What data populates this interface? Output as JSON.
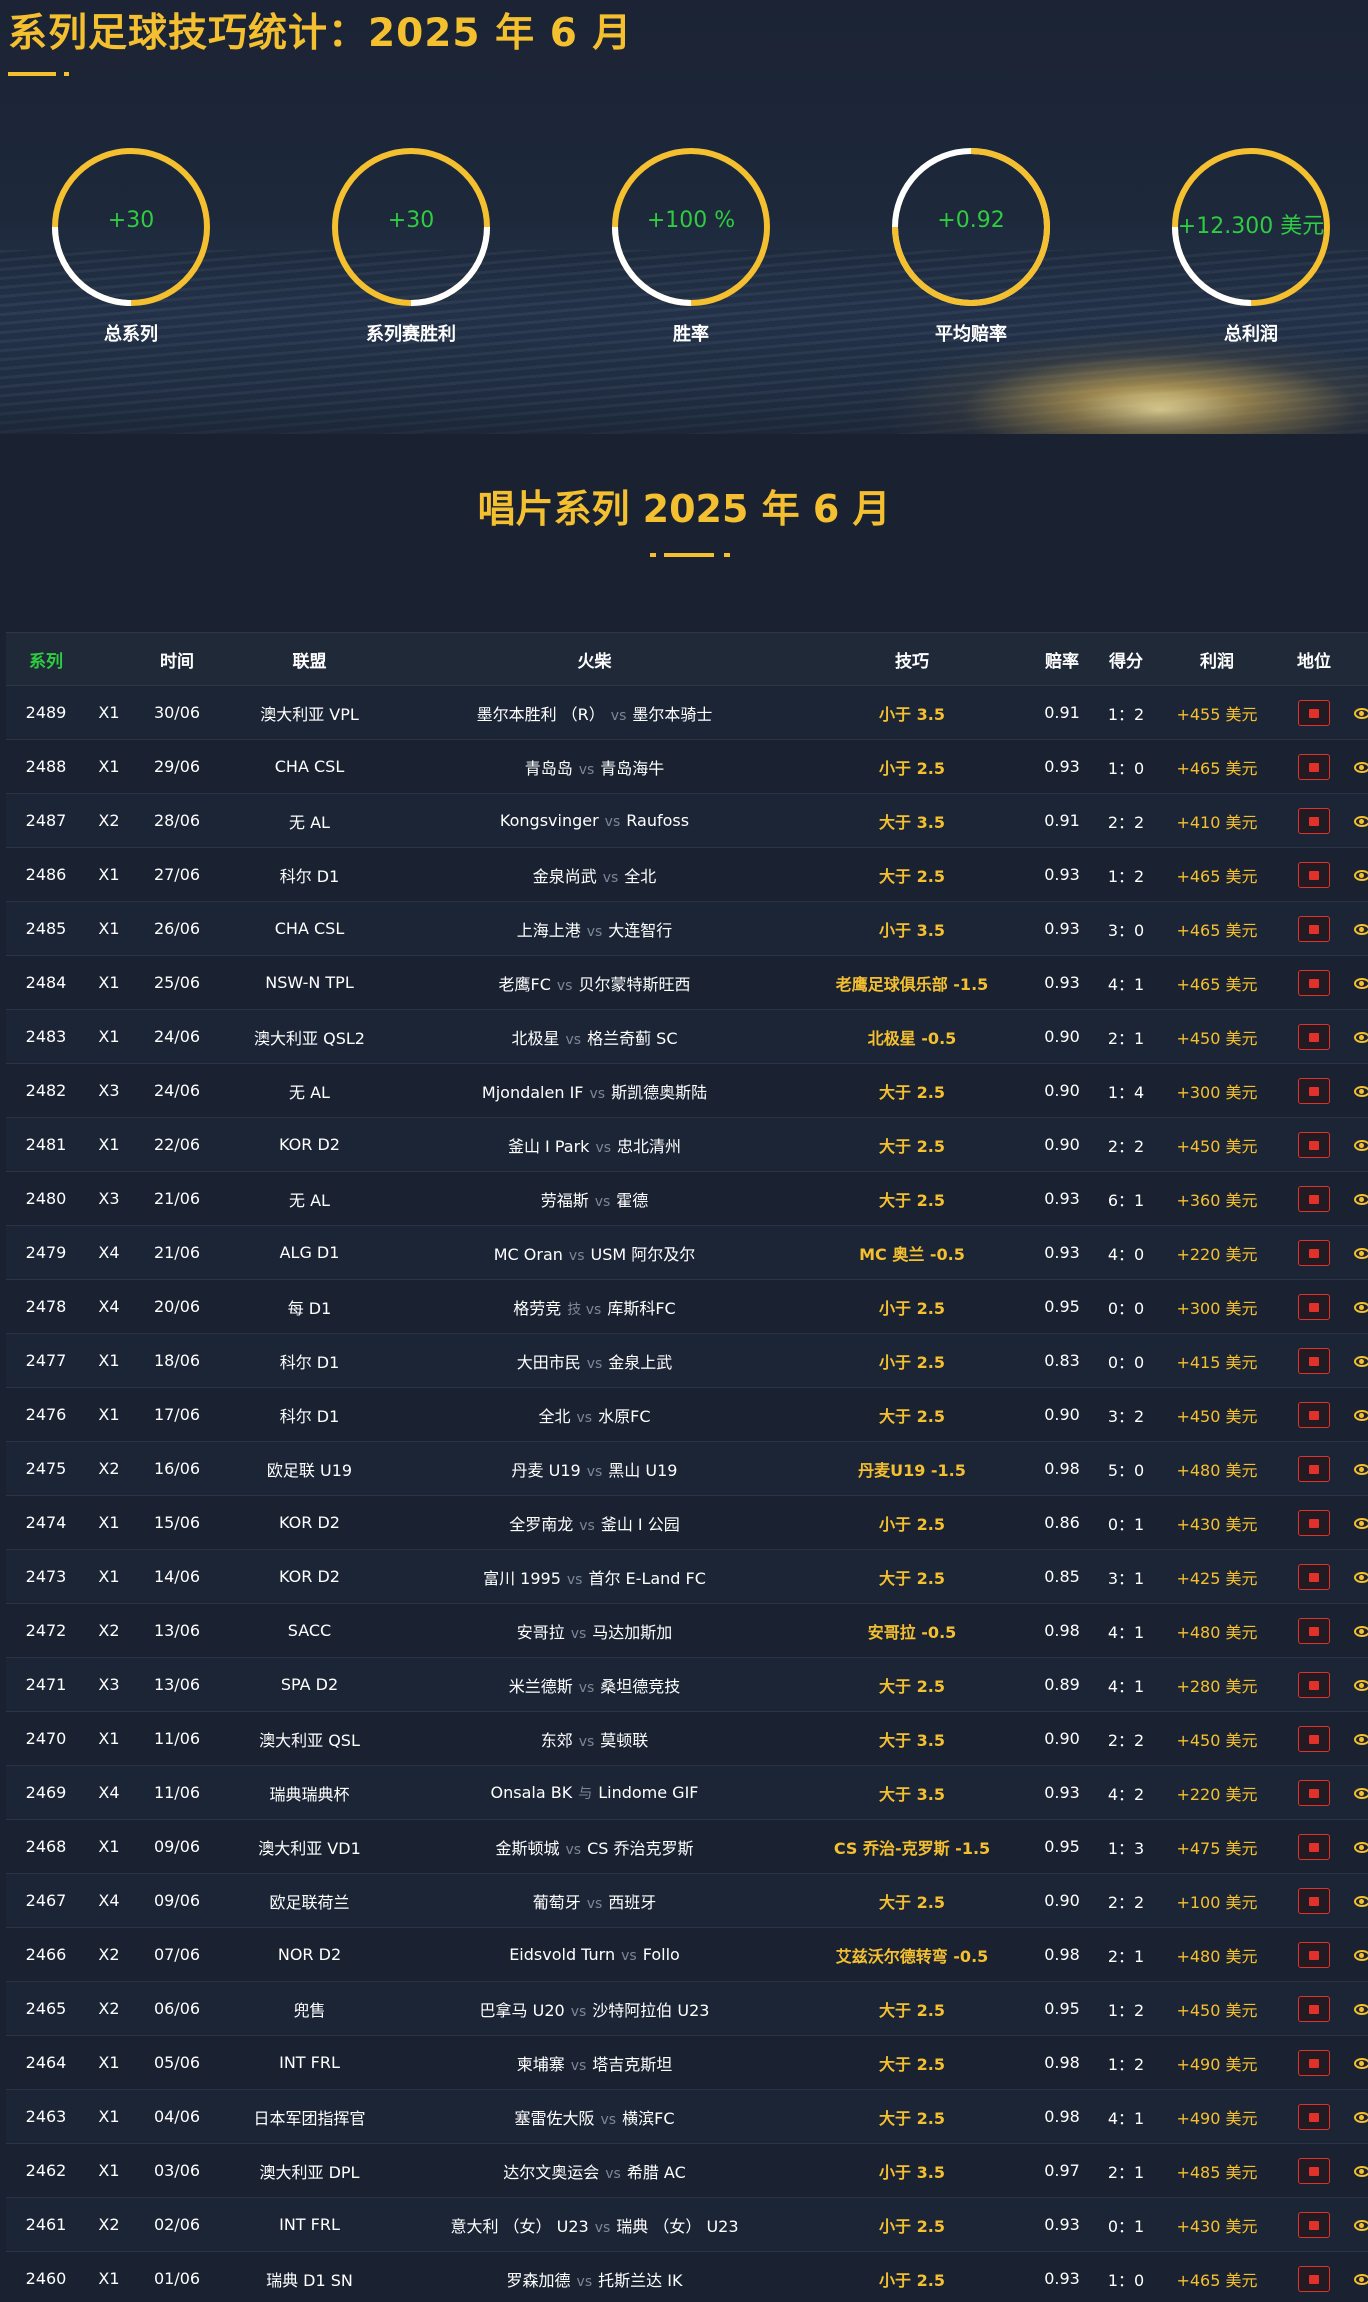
{
  "page": {
    "title": "系列足球技巧统计：2025 年 6 月",
    "section_title": "唱片系列 2025 年 6 月"
  },
  "stats": [
    {
      "value": "+30",
      "label": "总系列"
    },
    {
      "value": "+30",
      "label": "系列赛胜利"
    },
    {
      "value": "+100 %",
      "label": "胜率"
    },
    {
      "value": "+0.92",
      "label": "平均赔率"
    },
    {
      "value": "+12.300 美元",
      "label": "总利润"
    }
  ],
  "colors": {
    "accent": "#f5c030",
    "positive": "#2ecc40",
    "loss_badge": "#e0312b",
    "background": "#1a2232"
  },
  "table": {
    "headers": {
      "id": "系列",
      "time": "时间",
      "league": "联盟",
      "match": "火柴",
      "tip": "技巧",
      "odds": "赔率",
      "score": "得分",
      "profit": "利润",
      "status": "地位"
    },
    "rows": [
      {
        "id": "2489",
        "x": "X1",
        "date": "30/06",
        "league": "澳大利亚 VPL",
        "home": "墨尔本胜利 （R）",
        "sep": "vs",
        "away": "墨尔本骑士",
        "tip": "小于 3.5",
        "odds": "0.91",
        "score": "1：2",
        "profit": "+455 美元"
      },
      {
        "id": "2488",
        "x": "X1",
        "date": "29/06",
        "league": "CHA CSL",
        "home": "青岛岛",
        "sep": "vs",
        "away": "青岛海牛",
        "tip": "小于 2.5",
        "odds": "0.93",
        "score": "1：0",
        "profit": "+465 美元"
      },
      {
        "id": "2487",
        "x": "X2",
        "date": "28/06",
        "league": "无 AL",
        "home": "Kongsvinger",
        "sep": "vs",
        "away": "Raufoss",
        "tip": "大于 3.5",
        "odds": "0.91",
        "score": "2：2",
        "profit": "+410 美元"
      },
      {
        "id": "2486",
        "x": "X1",
        "date": "27/06",
        "league": "科尔 D1",
        "home": "金泉尚武",
        "sep": "vs",
        "away": "全北",
        "tip": "大于 2.5",
        "odds": "0.93",
        "score": "1：2",
        "profit": "+465 美元"
      },
      {
        "id": "2485",
        "x": "X1",
        "date": "26/06",
        "league": "CHA CSL",
        "home": "上海上港",
        "sep": "vs",
        "away": "大连智行",
        "tip": "小于 3.5",
        "odds": "0.93",
        "score": "3：0",
        "profit": "+465 美元"
      },
      {
        "id": "2484",
        "x": "X1",
        "date": "25/06",
        "league": "NSW-N TPL",
        "home": "老鹰FC",
        "sep": "vs",
        "away": "贝尔蒙特斯旺西",
        "tip": "老鹰足球俱乐部 -1.5",
        "odds": "0.93",
        "score": "4：1",
        "profit": "+465 美元"
      },
      {
        "id": "2483",
        "x": "X1",
        "date": "24/06",
        "league": "澳大利亚 QSL2",
        "home": "北极星",
        "sep": "vs",
        "away": "格兰奇蓟 SC",
        "tip": "北极星 -0.5",
        "odds": "0.90",
        "score": "2：1",
        "profit": "+450 美元"
      },
      {
        "id": "2482",
        "x": "X3",
        "date": "24/06",
        "league": "无 AL",
        "home": "Mjondalen IF",
        "sep": "vs",
        "away": "斯凯德奥斯陆",
        "tip": "大于 2.5",
        "odds": "0.90",
        "score": "1：4",
        "profit": "+300 美元"
      },
      {
        "id": "2481",
        "x": "X1",
        "date": "22/06",
        "league": "KOR D2",
        "home": "釜山 I Park",
        "sep": "vs",
        "away": "忠北清州",
        "tip": "大于 2.5",
        "odds": "0.90",
        "score": "2：2",
        "profit": "+450 美元"
      },
      {
        "id": "2480",
        "x": "X3",
        "date": "21/06",
        "league": "无 AL",
        "home": "劳福斯",
        "sep": "vs",
        "away": "霍德",
        "tip": "大于 2.5",
        "odds": "0.93",
        "score": "6：1",
        "profit": "+360 美元"
      },
      {
        "id": "2479",
        "x": "X4",
        "date": "21/06",
        "league": "ALG D1",
        "home": "MC Oran",
        "sep": "vs",
        "away": "USM 阿尔及尔",
        "tip": "MC 奥兰 -0.5",
        "odds": "0.93",
        "score": "4：0",
        "profit": "+220 美元"
      },
      {
        "id": "2478",
        "x": "X4",
        "date": "20/06",
        "league": "每 D1",
        "home": "格劳竞",
        "sep": "技 vs",
        "away": "库斯科FC",
        "tip": "小于 2.5",
        "odds": "0.95",
        "score": "0：0",
        "profit": "+300 美元"
      },
      {
        "id": "2477",
        "x": "X1",
        "date": "18/06",
        "league": "科尔 D1",
        "home": "大田市民",
        "sep": "vs",
        "away": "金泉上武",
        "tip": "小于 2.5",
        "odds": "0.83",
        "score": "0：0",
        "profit": "+415 美元"
      },
      {
        "id": "2476",
        "x": "X1",
        "date": "17/06",
        "league": "科尔 D1",
        "home": "全北",
        "sep": "vs",
        "away": "水原FC",
        "tip": "大于 2.5",
        "odds": "0.90",
        "score": "3：2",
        "profit": "+450 美元"
      },
      {
        "id": "2475",
        "x": "X2",
        "date": "16/06",
        "league": "欧足联 U19",
        "home": "丹麦 U19",
        "sep": "vs",
        "away": "黑山 U19",
        "tip": "丹麦U19 -1.5",
        "odds": "0.98",
        "score": "5：0",
        "profit": "+480 美元"
      },
      {
        "id": "2474",
        "x": "X1",
        "date": "15/06",
        "league": "KOR D2",
        "home": "全罗南龙",
        "sep": "vs",
        "away": "釜山 I 公园",
        "tip": "小于 2.5",
        "odds": "0.86",
        "score": "0：1",
        "profit": "+430 美元"
      },
      {
        "id": "2473",
        "x": "X1",
        "date": "14/06",
        "league": "KOR D2",
        "home": "富川 1995",
        "sep": "vs",
        "away": "首尔 E-Land FC",
        "tip": "大于 2.5",
        "odds": "0.85",
        "score": "3：1",
        "profit": "+425 美元"
      },
      {
        "id": "2472",
        "x": "X2",
        "date": "13/06",
        "league": "SACC",
        "home": "安哥拉",
        "sep": "vs",
        "away": "马达加斯加",
        "tip": "安哥拉 -0.5",
        "odds": "0.98",
        "score": "4：1",
        "profit": "+480 美元"
      },
      {
        "id": "2471",
        "x": "X3",
        "date": "13/06",
        "league": "SPA D2",
        "home": "米兰德斯",
        "sep": "vs",
        "away": "桑坦德竞技",
        "tip": "大于 2.5",
        "odds": "0.89",
        "score": "4：1",
        "profit": "+280 美元"
      },
      {
        "id": "2470",
        "x": "X1",
        "date": "11/06",
        "league": "澳大利亚 QSL",
        "home": "东郊",
        "sep": "vs",
        "away": "莫顿联",
        "tip": "大于 3.5",
        "odds": "0.90",
        "score": "2：2",
        "profit": "+450 美元"
      },
      {
        "id": "2469",
        "x": "X4",
        "date": "11/06",
        "league": "瑞典瑞典杯",
        "home": "Onsala BK",
        "sep": "与",
        "away": "Lindome GIF",
        "tip": "大于 3.5",
        "odds": "0.93",
        "score": "4：2",
        "profit": "+220 美元"
      },
      {
        "id": "2468",
        "x": "X1",
        "date": "09/06",
        "league": "澳大利亚 VD1",
        "home": "金斯顿城",
        "sep": "vs",
        "away": "CS 乔治克罗斯",
        "tip": "CS 乔治-克罗斯 -1.5",
        "odds": "0.95",
        "score": "1：3",
        "profit": "+475 美元"
      },
      {
        "id": "2467",
        "x": "X4",
        "date": "09/06",
        "league": "欧足联荷兰",
        "home": "葡萄牙",
        "sep": "vs",
        "away": "西班牙",
        "tip": "大于 2.5",
        "odds": "0.90",
        "score": "2：2",
        "profit": "+100 美元"
      },
      {
        "id": "2466",
        "x": "X2",
        "date": "07/06",
        "league": "NOR D2",
        "home": "Eidsvold Turn",
        "sep": "vs",
        "away": "Follo",
        "tip": "艾兹沃尔德转弯 -0.5",
        "odds": "0.98",
        "score": "2：1",
        "profit": "+480 美元"
      },
      {
        "id": "2465",
        "x": "X2",
        "date": "06/06",
        "league": "兜售",
        "home": "巴拿马 U20",
        "sep": "vs",
        "away": "沙特阿拉伯 U23",
        "tip": "大于 2.5",
        "odds": "0.95",
        "score": "1：2",
        "profit": "+450 美元"
      },
      {
        "id": "2464",
        "x": "X1",
        "date": "05/06",
        "league": "INT FRL",
        "home": "柬埔寨",
        "sep": "vs",
        "away": "塔吉克斯坦",
        "tip": "大于 2.5",
        "odds": "0.98",
        "score": "1：2",
        "profit": "+490 美元"
      },
      {
        "id": "2463",
        "x": "X1",
        "date": "04/06",
        "league": "日本军团指挥官",
        "home": "塞雷佐大阪",
        "sep": "vs",
        "away": "横滨FC",
        "tip": "大于 2.5",
        "odds": "0.98",
        "score": "4：1",
        "profit": "+490 美元"
      },
      {
        "id": "2462",
        "x": "X1",
        "date": "03/06",
        "league": "澳大利亚 DPL",
        "home": "达尔文奥运会",
        "sep": "vs",
        "away": "希腊 AC",
        "tip": "小于 3.5",
        "odds": "0.97",
        "score": "2：1",
        "profit": "+485 美元"
      },
      {
        "id": "2461",
        "x": "X2",
        "date": "02/06",
        "league": "INT FRL",
        "home": "意大利 （女） U23",
        "sep": "vs",
        "away": "瑞典 （女） U23",
        "tip": "小于 2.5",
        "odds": "0.93",
        "score": "0：1",
        "profit": "+430 美元"
      },
      {
        "id": "2460",
        "x": "X1",
        "date": "01/06",
        "league": "瑞典 D1 SN",
        "home": "罗森加德",
        "sep": "vs",
        "away": "托斯兰达 IK",
        "tip": "小于 2.5",
        "odds": "0.93",
        "score": "1：0",
        "profit": "+465 美元"
      }
    ]
  }
}
